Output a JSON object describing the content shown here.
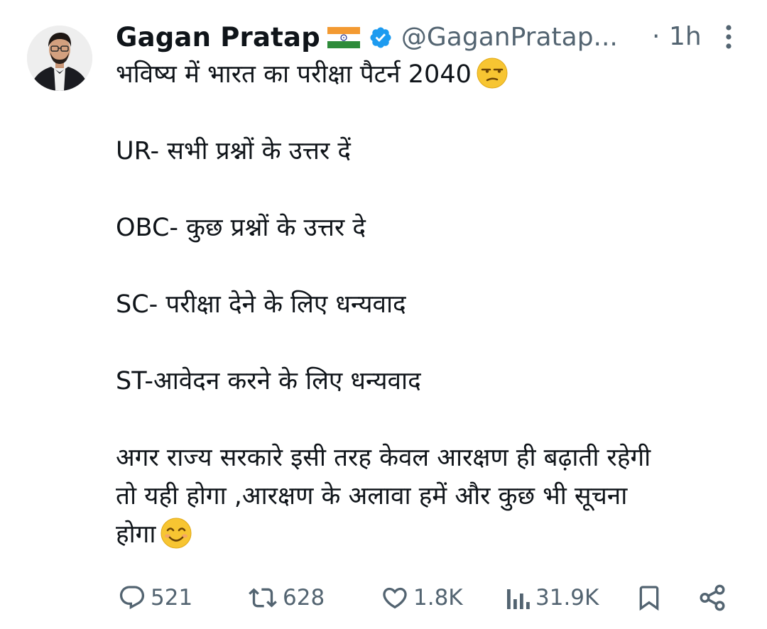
{
  "tweet": {
    "author": {
      "name": "Gagan Pratap",
      "handle": "@GaganPratap...",
      "flag_icon": "india-flag-icon",
      "verified_icon": "verified-badge-icon"
    },
    "separator": "·",
    "time": "1h",
    "lines": [
      "भविष्य में भारत का परीक्षा पैटर्न 2040",
      "",
      "UR- सभी प्रश्नों के उत्तर दें",
      "",
      "OBC- कुछ प्रश्नों के उत्तर दे",
      "",
      "SC- परीक्षा देने के लिए धन्यवाद",
      "",
      "ST-आवेदन करने के लिए धन्यवाद",
      "",
      "अगर राज्य सरकारे इसी तरह केवल आरक्षण ही बढ़ाती रहेगी",
      "तो यही होगा ,आरक्षण के अलावा हमें और कुछ भी सूचना",
      "होगा"
    ],
    "emojis": {
      "first_line": "unamused-face-emoji",
      "last_line": "smiling-face-emoji"
    },
    "actions": {
      "reply": {
        "icon": "reply-icon",
        "count": "521"
      },
      "retweet": {
        "icon": "retweet-icon",
        "count": "628"
      },
      "like": {
        "icon": "heart-icon",
        "count": "1.8K"
      },
      "views": {
        "icon": "views-icon",
        "count": "31.9K"
      },
      "bookmark": {
        "icon": "bookmark-icon"
      },
      "share": {
        "icon": "share-icon"
      }
    },
    "colors": {
      "text": "#0f1419",
      "secondary": "#536471",
      "verified": "#1d9bf0"
    }
  }
}
